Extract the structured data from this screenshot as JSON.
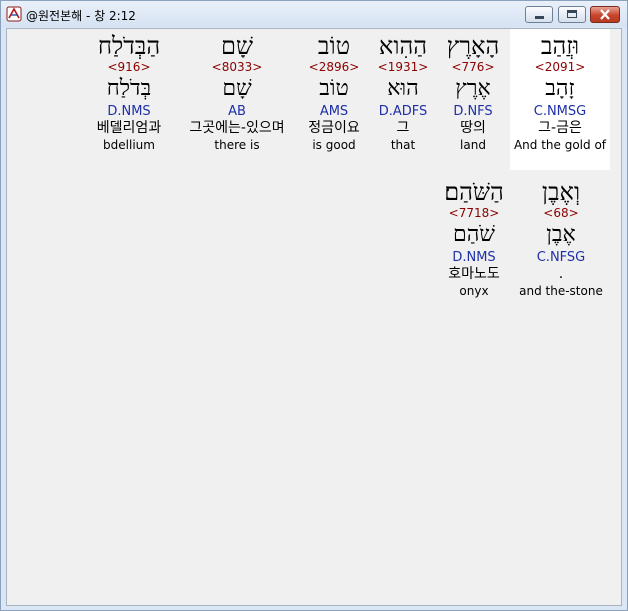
{
  "window": {
    "title": "@원전본해 - 창 2:12"
  },
  "row1": [
    {
      "hebrew": "וּזֲהַב",
      "strong": "<2091>",
      "lexeme": "זָהָב",
      "morph": "C.NMSG",
      "korean": "그-금은",
      "english": "And the gold of"
    },
    {
      "hebrew": "הָאָרֶץ",
      "strong": "<776>",
      "lexeme": "אֶרֶץ",
      "morph": "D.NFS",
      "korean": "땅의",
      "english": "land"
    },
    {
      "hebrew": "הַהִוא",
      "strong": "<1931>",
      "lexeme": "הוּא",
      "morph": "D.ADFS",
      "korean": "그",
      "english": "that"
    },
    {
      "hebrew": "טוֹב",
      "strong": "<2896>",
      "lexeme": "טוֹב",
      "morph": "AMS",
      "korean": "정금이요",
      "english": "is good"
    },
    {
      "hebrew": "שָׁם",
      "strong": "<8033>",
      "lexeme": "שָׁם",
      "morph": "AB",
      "korean": "그곳에는-있으며",
      "english": "there is"
    },
    {
      "hebrew": "הַבְּדֹלַח",
      "strong": "<916>",
      "lexeme": "בְּדֹלַח",
      "morph": "D.NMS",
      "korean": "베델리엄과",
      "english": "bdellium"
    }
  ],
  "row2": [
    {
      "hebrew": "וְאֶבֶן",
      "strong": "<68>",
      "lexeme": "אֶבֶן",
      "morph": "C.NFSG",
      "korean": ".",
      "english": "and the-stone"
    },
    {
      "hebrew": "הַשֹּׁהַם׃",
      "strong": "<7718>",
      "lexeme": "שֹׁהַם",
      "morph": "D.NMS",
      "korean": "호마노도",
      "english": "onyx"
    }
  ],
  "colors": {
    "strong": "#8b0000",
    "morph": "#1e2fa8",
    "highlight": "#ffffff"
  }
}
